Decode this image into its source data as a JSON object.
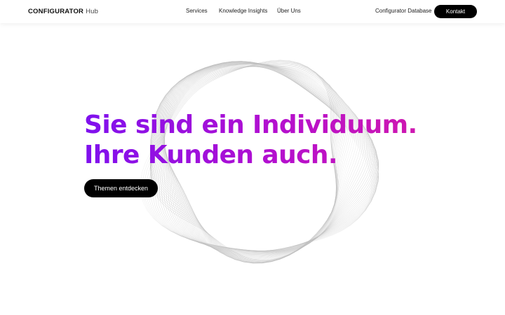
{
  "header": {
    "logo_strong": "CONFIGURATOR",
    "logo_light": "Hub",
    "nav": [
      "Services",
      "Knowledge Insights",
      "Über Uns"
    ],
    "database_link": "Configurator Database",
    "contact_button": "Kontakt"
  },
  "hero": {
    "headline_line1": "Sie sind ein Individuum.",
    "headline_line2": "Ihre Kunden auch.",
    "cta_label": "Themen entdecken"
  },
  "colors": {
    "gradient_start": "#7f10ee",
    "gradient_end": "#cf18b0",
    "button_bg": "#000000",
    "blob_stroke": "#bdbdbd"
  },
  "icons": {
    "decoration": "wireframe-blob"
  }
}
